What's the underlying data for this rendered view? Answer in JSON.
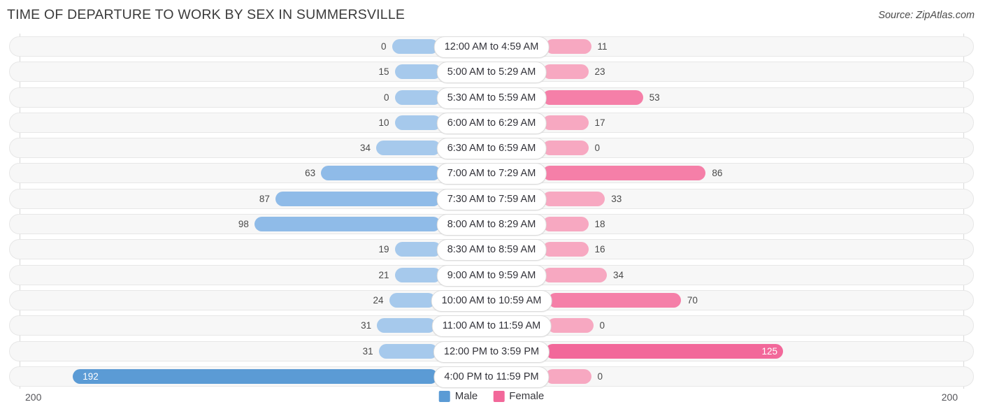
{
  "header": {
    "title": "TIME OF DEPARTURE TO WORK BY SEX IN SUMMERSVILLE",
    "source": "Source: ZipAtlas.com"
  },
  "legend": {
    "male_label": "Male",
    "female_label": "Female",
    "male_color": "#5b9bd5",
    "female_color": "#f2689a"
  },
  "axis": {
    "left_value": "200",
    "right_value": "200"
  },
  "chart_data": {
    "type": "bar",
    "title": "TIME OF DEPARTURE TO WORK BY SEX IN SUMMERSVILLE",
    "subtitle": "Source: ZipAtlas.com",
    "orientation": "horizontal-diverging",
    "xlabel": "",
    "ylabel": "",
    "xlim": [
      200,
      200
    ],
    "grid": false,
    "legend_position": "bottom-center",
    "categories": [
      "12:00 AM to 4:59 AM",
      "5:00 AM to 5:29 AM",
      "5:30 AM to 5:59 AM",
      "6:00 AM to 6:29 AM",
      "6:30 AM to 6:59 AM",
      "7:00 AM to 7:29 AM",
      "7:30 AM to 7:59 AM",
      "8:00 AM to 8:29 AM",
      "8:30 AM to 8:59 AM",
      "9:00 AM to 9:59 AM",
      "10:00 AM to 10:59 AM",
      "11:00 AM to 11:59 AM",
      "12:00 PM to 3:59 PM",
      "4:00 PM to 11:59 PM"
    ],
    "series": [
      {
        "name": "Male",
        "color": "#5b9bd5",
        "values": [
          0,
          15,
          0,
          10,
          34,
          63,
          87,
          98,
          19,
          21,
          24,
          31,
          31,
          192
        ]
      },
      {
        "name": "Female",
        "color": "#f2689a",
        "values": [
          11,
          23,
          53,
          17,
          0,
          86,
          33,
          18,
          16,
          34,
          70,
          0,
          125,
          0
        ]
      }
    ]
  },
  "rows": [
    {
      "category": "12:00 AM to 4:59 AM",
      "male": "0",
      "female": "11"
    },
    {
      "category": "5:00 AM to 5:29 AM",
      "male": "15",
      "female": "23"
    },
    {
      "category": "5:30 AM to 5:59 AM",
      "male": "0",
      "female": "53"
    },
    {
      "category": "6:00 AM to 6:29 AM",
      "male": "10",
      "female": "17"
    },
    {
      "category": "6:30 AM to 6:59 AM",
      "male": "34",
      "female": "0"
    },
    {
      "category": "7:00 AM to 7:29 AM",
      "male": "63",
      "female": "86"
    },
    {
      "category": "7:30 AM to 7:59 AM",
      "male": "87",
      "female": "33"
    },
    {
      "category": "8:00 AM to 8:29 AM",
      "male": "98",
      "female": "18"
    },
    {
      "category": "8:30 AM to 8:59 AM",
      "male": "19",
      "female": "16"
    },
    {
      "category": "9:00 AM to 9:59 AM",
      "male": "21",
      "female": "34"
    },
    {
      "category": "10:00 AM to 10:59 AM",
      "male": "24",
      "female": "70"
    },
    {
      "category": "11:00 AM to 11:59 AM",
      "male": "31",
      "female": "0"
    },
    {
      "category": "12:00 PM to 3:59 PM",
      "male": "31",
      "female": "125"
    },
    {
      "category": "4:00 PM to 11:59 PM",
      "male": "192",
      "female": "0"
    }
  ]
}
